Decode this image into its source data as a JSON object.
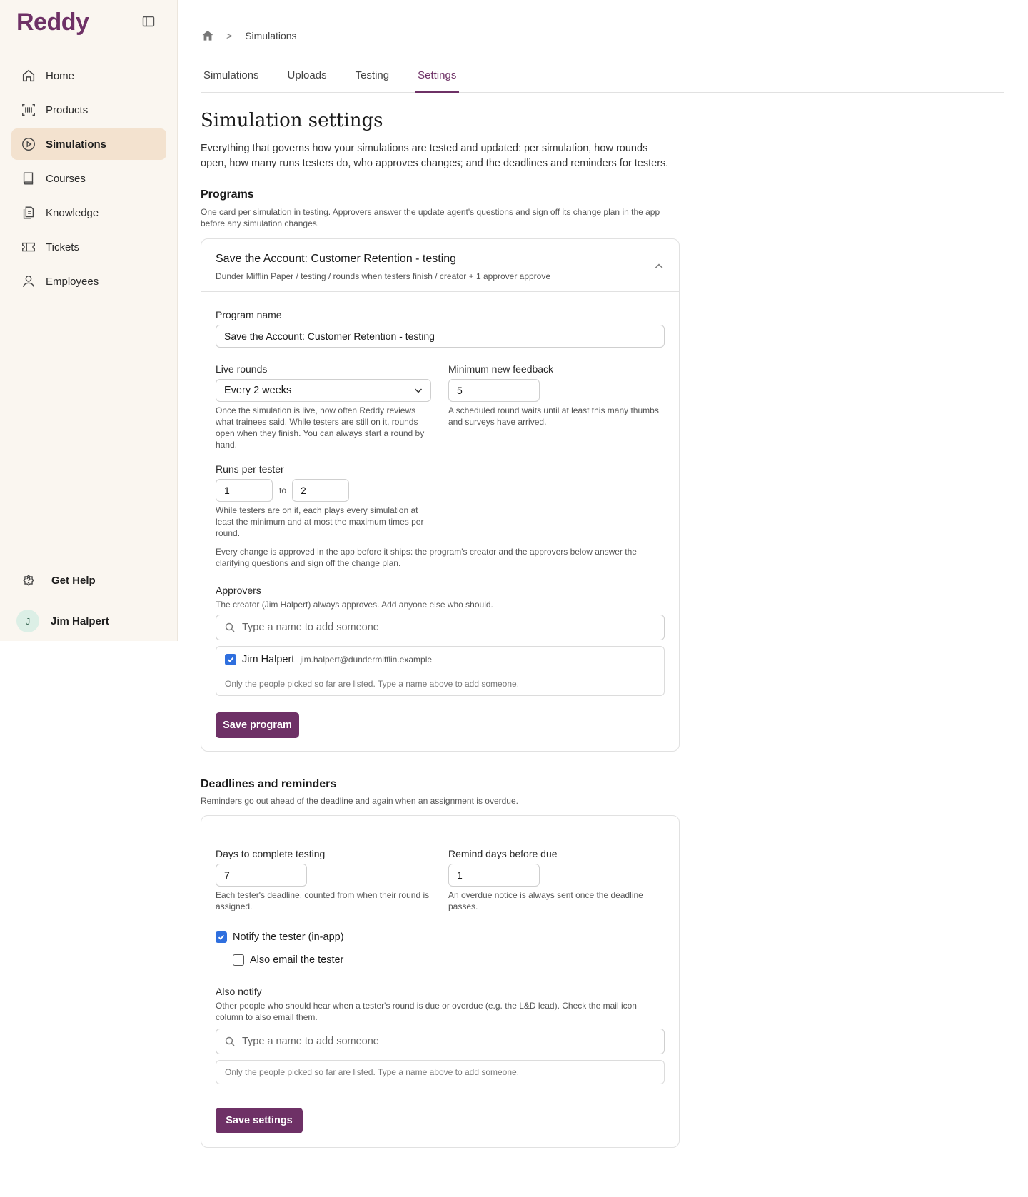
{
  "app": {
    "logo": "Reddy"
  },
  "sidebar": {
    "items": [
      {
        "label": "Home",
        "icon": "home-icon"
      },
      {
        "label": "Products",
        "icon": "barcode-icon"
      },
      {
        "label": "Simulations",
        "icon": "play-circle-icon",
        "active": true
      },
      {
        "label": "Courses",
        "icon": "book-icon"
      },
      {
        "label": "Knowledge",
        "icon": "document-icon"
      },
      {
        "label": "Tickets",
        "icon": "ticket-icon"
      },
      {
        "label": "Employees",
        "icon": "user-icon"
      }
    ],
    "help_label": "Get Help",
    "user": {
      "initial": "J",
      "name": "Jim Halpert"
    }
  },
  "breadcrumb": {
    "current": "Simulations",
    "separator": ">"
  },
  "tabs": [
    "Simulations",
    "Uploads",
    "Testing",
    "Settings"
  ],
  "active_tab": "Settings",
  "page": {
    "title": "Simulation settings",
    "description": "Everything that governs how your simulations are tested and updated: per simulation, how rounds open, how many runs testers do, who approves changes; and the deadlines and reminders for testers."
  },
  "programs": {
    "title": "Programs",
    "description": "One card per simulation in testing. Approvers answer the update agent's questions and sign off its change plan in the app before any simulation changes.",
    "card": {
      "title": "Save the Account: Customer Retention - testing",
      "subtitle": "Dunder Mifflin Paper / testing / rounds when testers finish / creator + 1 approver approve",
      "program_name_label": "Program name",
      "program_name_value": "Save the Account: Customer Retention - testing",
      "live_rounds_label": "Live rounds",
      "live_rounds_value": "Every 2 weeks",
      "live_rounds_help": "Once the simulation is live, how often Reddy reviews what trainees said. While testers are still on it, rounds open when they finish. You can always start a round by hand.",
      "min_feedback_label": "Minimum new feedback",
      "min_feedback_value": "5",
      "min_feedback_help": "A scheduled round waits until at least this many thumbs and surveys have arrived.",
      "runs_label": "Runs per tester",
      "runs_min": "1",
      "runs_to": "to",
      "runs_max": "2",
      "runs_help": "While testers are on it, each plays every simulation at least the minimum and at most the maximum times per round.",
      "approval_note": "Every change is approved in the app before it ships: the program's creator and the approvers below answer the clarifying questions and sign off the change plan.",
      "approvers_label": "Approvers",
      "approvers_help": "The creator (Jim Halpert) always approves. Add anyone else who should.",
      "search_placeholder": "Type a name to add someone",
      "approver_name": "Jim Halpert",
      "approver_email": "jim.halpert@dundermifflin.example",
      "picked_note": "Only the people picked so far are listed. Type a name above to add someone.",
      "save_label": "Save program"
    }
  },
  "deadlines": {
    "title": "Deadlines and reminders",
    "description": "Reminders go out ahead of the deadline and again when an assignment is overdue.",
    "days_label": "Days to complete testing",
    "days_value": "7",
    "days_help": "Each tester's deadline, counted from when their round is assigned.",
    "remind_label": "Remind days before due",
    "remind_value": "1",
    "remind_help": "An overdue notice is always sent once the deadline passes.",
    "notify_label": "Notify the tester (in-app)",
    "notify_checked": true,
    "email_label": "Also email the tester",
    "email_checked": false,
    "also_notify_label": "Also notify",
    "also_notify_help": "Other people who should hear when a tester's round is due or overdue (e.g. the L&D lead). Check the mail icon column to also email them.",
    "search_placeholder": "Type a name to add someone",
    "picked_note": "Only the people picked so far are listed. Type a name above to add someone.",
    "save_label": "Save settings"
  },
  "colors": {
    "accent": "#6e3166",
    "sidebar_bg": "#faf6f0",
    "active_nav": "#f3e2cf",
    "checkbox": "#2f6fde"
  }
}
